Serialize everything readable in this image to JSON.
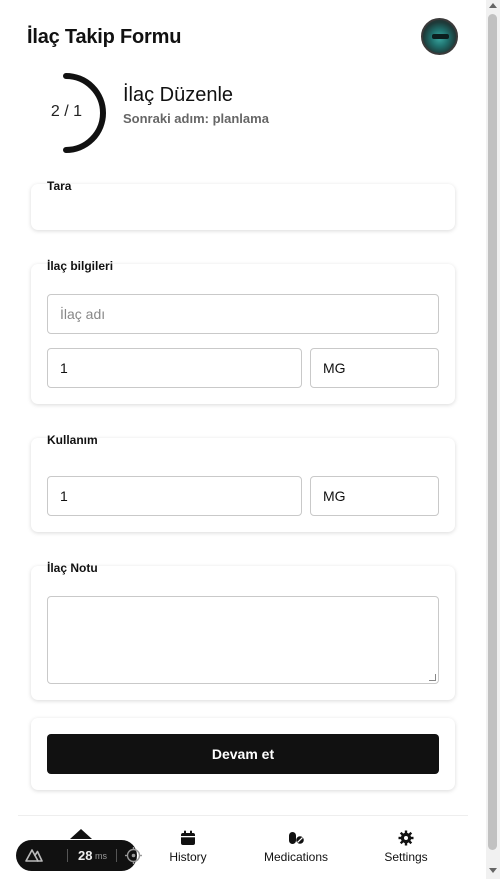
{
  "app": {
    "title": "İlaç Takip Formu"
  },
  "progress": {
    "text": "2 / 1",
    "fraction": 0.5
  },
  "step": {
    "title": "İlaç Düzenle",
    "subtitle": "Sonraki adım: planlama"
  },
  "sections": {
    "scan": {
      "label": "Tara"
    },
    "info": {
      "label": "İlaç bilgileri",
      "name_placeholder": "İlaç adı",
      "dose_value": "1",
      "unit_value": "MG"
    },
    "usage": {
      "label": "Kullanım",
      "amount_value": "1",
      "unit_value": "MG"
    },
    "note": {
      "label": "İlaç Notu",
      "value": ""
    }
  },
  "actions": {
    "continue_label": "Devam et"
  },
  "nav": {
    "items": [
      {
        "label": "",
        "icon": "home-icon"
      },
      {
        "label": "History",
        "icon": "calendar-icon"
      },
      {
        "label": "Medications",
        "icon": "pills-icon"
      },
      {
        "label": "Settings",
        "icon": "gear-icon"
      }
    ]
  },
  "devtools": {
    "ms_value": "28",
    "ms_unit": "ms"
  },
  "colors": {
    "primary": "#111111",
    "border": "#c9c9c9",
    "muted": "#666666"
  }
}
